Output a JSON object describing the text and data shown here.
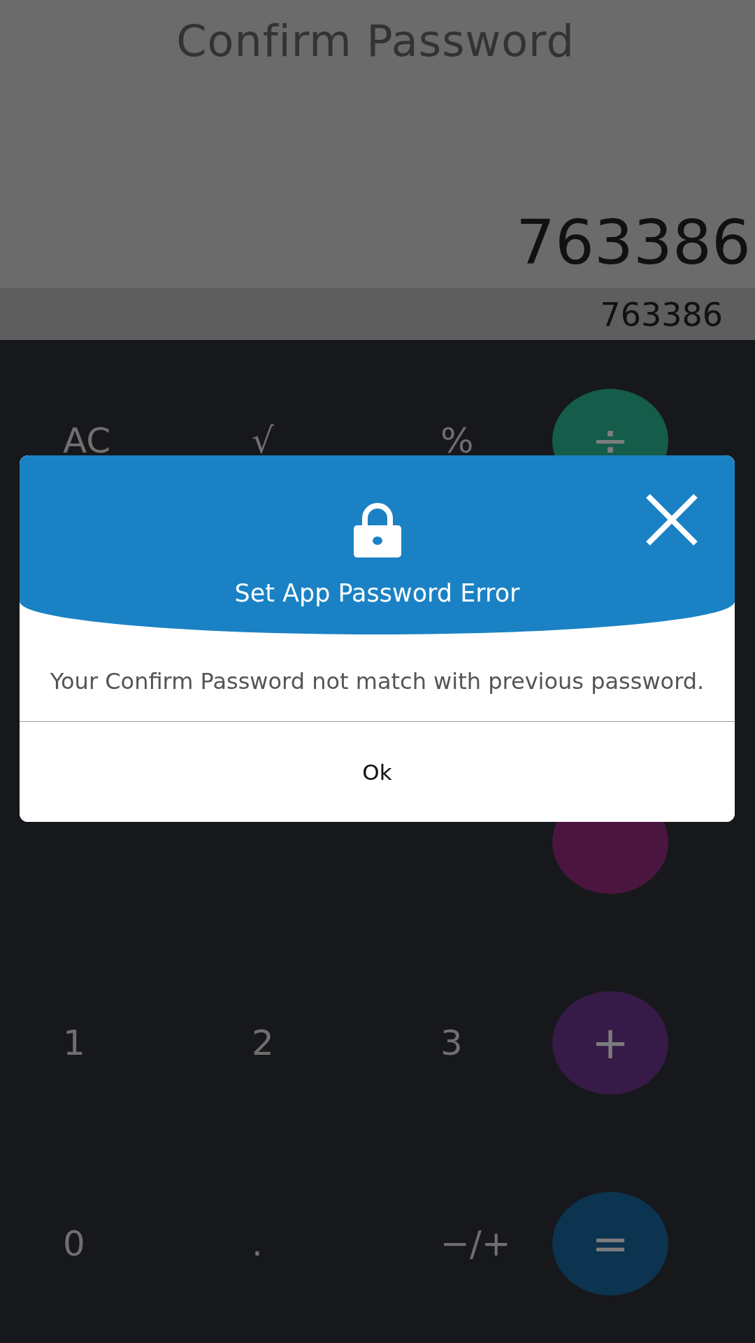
{
  "display": {
    "title": "Confirm Password",
    "main_value": "763386",
    "secondary_value": "763386"
  },
  "keypad": {
    "rows": [
      {
        "keys": [
          {
            "kind": "text",
            "label": "AC"
          },
          {
            "kind": "text",
            "label": "√"
          },
          {
            "kind": "text",
            "label": "%"
          },
          {
            "kind": "operator",
            "label": "÷",
            "color": "#155c4a"
          }
        ]
      },
      {
        "keys": []
      },
      {
        "keys": [
          {
            "kind": "spacer"
          },
          {
            "kind": "spacer"
          },
          {
            "kind": "spacer"
          },
          {
            "kind": "operator",
            "color": "#4a1640"
          }
        ]
      },
      {
        "keys": [
          {
            "kind": "text",
            "label": "1"
          },
          {
            "kind": "text",
            "label": "2"
          },
          {
            "kind": "text",
            "label": "3"
          },
          {
            "kind": "operator",
            "label": "+",
            "color": "#361a47"
          }
        ]
      },
      {
        "keys": [
          {
            "kind": "text",
            "label": "0"
          },
          {
            "kind": "text",
            "label": "."
          },
          {
            "kind": "text",
            "label": "−/+"
          },
          {
            "kind": "operator",
            "label": "=",
            "color": "#0c334f"
          }
        ]
      }
    ]
  },
  "dialog": {
    "title": "Set App Password Error",
    "message": "Your Confirm Password not match with previous password.",
    "button": "Ok"
  }
}
